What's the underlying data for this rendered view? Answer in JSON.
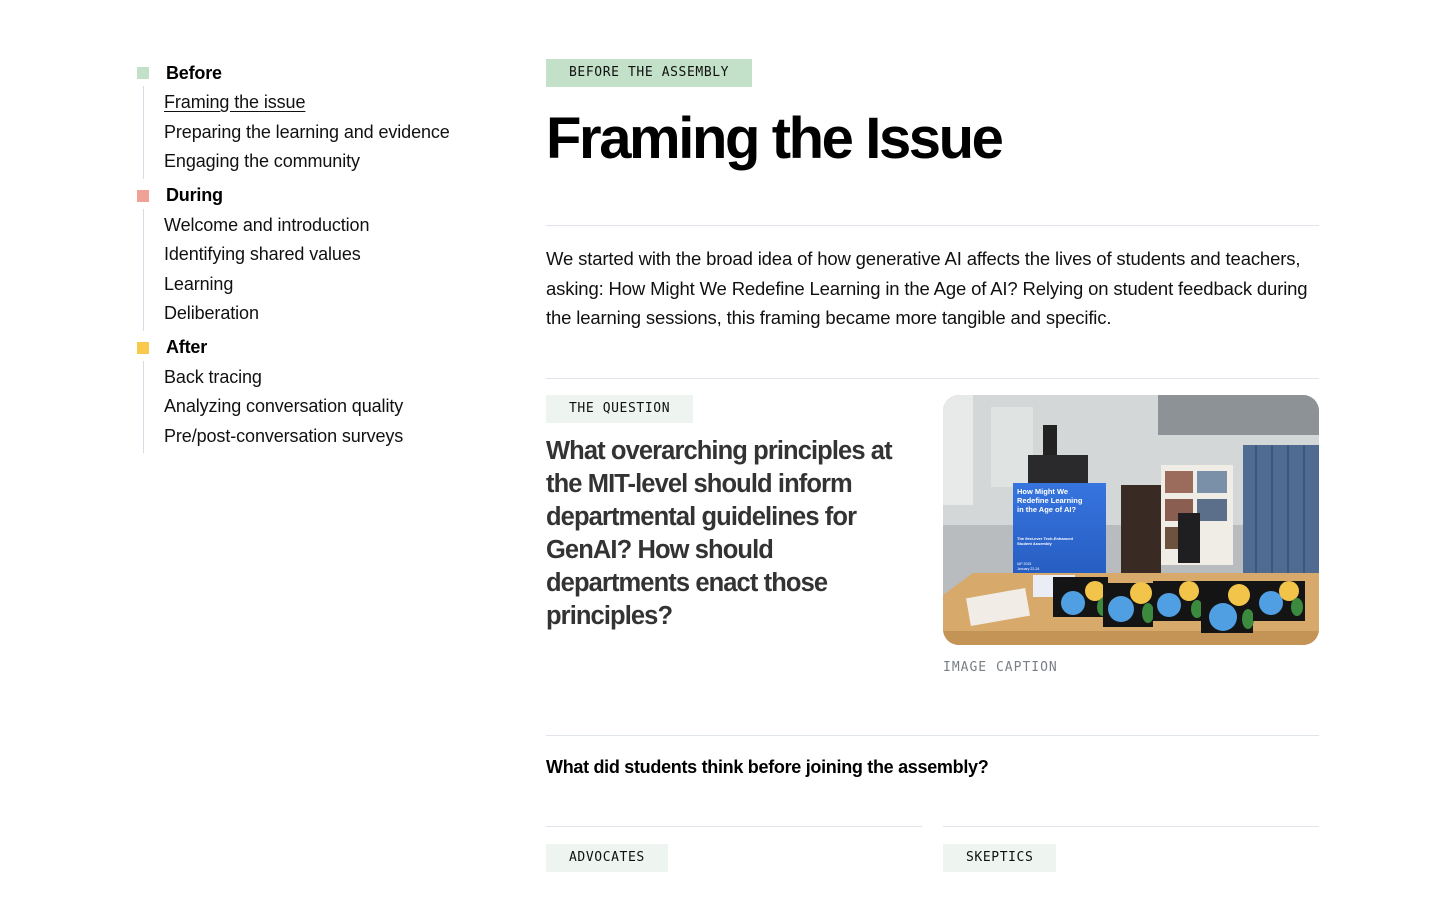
{
  "toc": {
    "groups": [
      {
        "title": "Before",
        "color": "#c3e1c8",
        "items": [
          "Framing the issue",
          "Preparing the learning and evidence",
          "Engaging the community"
        ]
      },
      {
        "title": "During",
        "color": "#f0a297",
        "items": [
          "Welcome and introduction",
          "Identifying shared values",
          "Learning",
          "Deliberation"
        ]
      },
      {
        "title": "After",
        "color": "#f8c94a",
        "items": [
          "Back tracing",
          "Analyzing conversation quality",
          "Pre/post-conversation surveys"
        ]
      }
    ],
    "active_item": "Framing the issue"
  },
  "main": {
    "section_tag": "BEFORE THE ASSEMBLY",
    "title": "Framing the Issue",
    "intro": "We started with the broad idea of how generative AI affects the lives of students and teachers, asking: How Might We Redefine Learning in the Age of AI? Relying on student feedback during the learning sessions, this framing became more tangible and specific.",
    "question": {
      "tag": "THE QUESTION",
      "text": "What overarching principles at the MIT-level should inform departmental guidelines for GenAI? How should departments enact those principles?"
    },
    "image": {
      "sign_title": "How Might We Redefine Learning in the Age of AI?",
      "sign_subtitle": "The first-ever Tech-Enhanced Student Assembly",
      "sign_date": "IAP 2024 January 22-24",
      "caption": "IMAGE CAPTION"
    },
    "subhead": "What did students think before joining the assembly?",
    "columns": [
      {
        "tag": "ADVOCATES"
      },
      {
        "tag": "SKEPTICS"
      }
    ]
  }
}
